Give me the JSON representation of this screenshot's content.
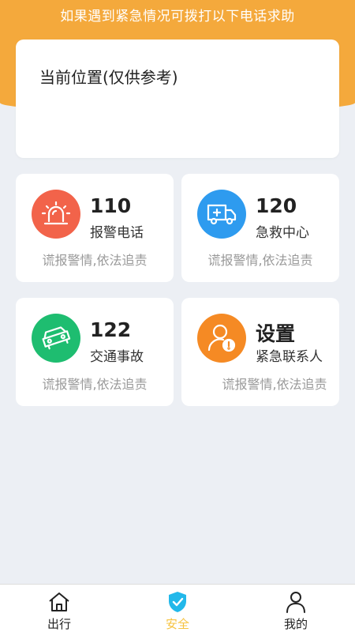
{
  "banner": {
    "text": "如果遇到紧急情况可拨打以下电话求助"
  },
  "location": {
    "title": "当前位置(仅供参考)"
  },
  "cards": [
    {
      "number": "110",
      "label": "报警电话",
      "note": "谎报警情,依法追责",
      "color": "#f2634a",
      "icon": "siren-icon"
    },
    {
      "number": "120",
      "label": "急救中心",
      "note": "谎报警情,依法追责",
      "color": "#2e9bef",
      "icon": "ambulance-icon"
    },
    {
      "number": "122",
      "label": "交通事故",
      "note": "谎报警情,依法追责",
      "color": "#1ebd70",
      "icon": "car-crash-icon"
    },
    {
      "number": "设置",
      "label": "紧急联系人",
      "note": "谎报警情,依法追责",
      "color": "#f58a24",
      "icon": "contact-alert-icon"
    }
  ],
  "nav": [
    {
      "label": "出行",
      "icon": "home-icon",
      "active": false
    },
    {
      "label": "安全",
      "icon": "shield-check-icon",
      "active": true
    },
    {
      "label": "我的",
      "icon": "user-icon",
      "active": false
    }
  ],
  "colors": {
    "header": "#f4a93c",
    "active_nav": "#f6c340",
    "active_icon": "#22b8ea"
  }
}
